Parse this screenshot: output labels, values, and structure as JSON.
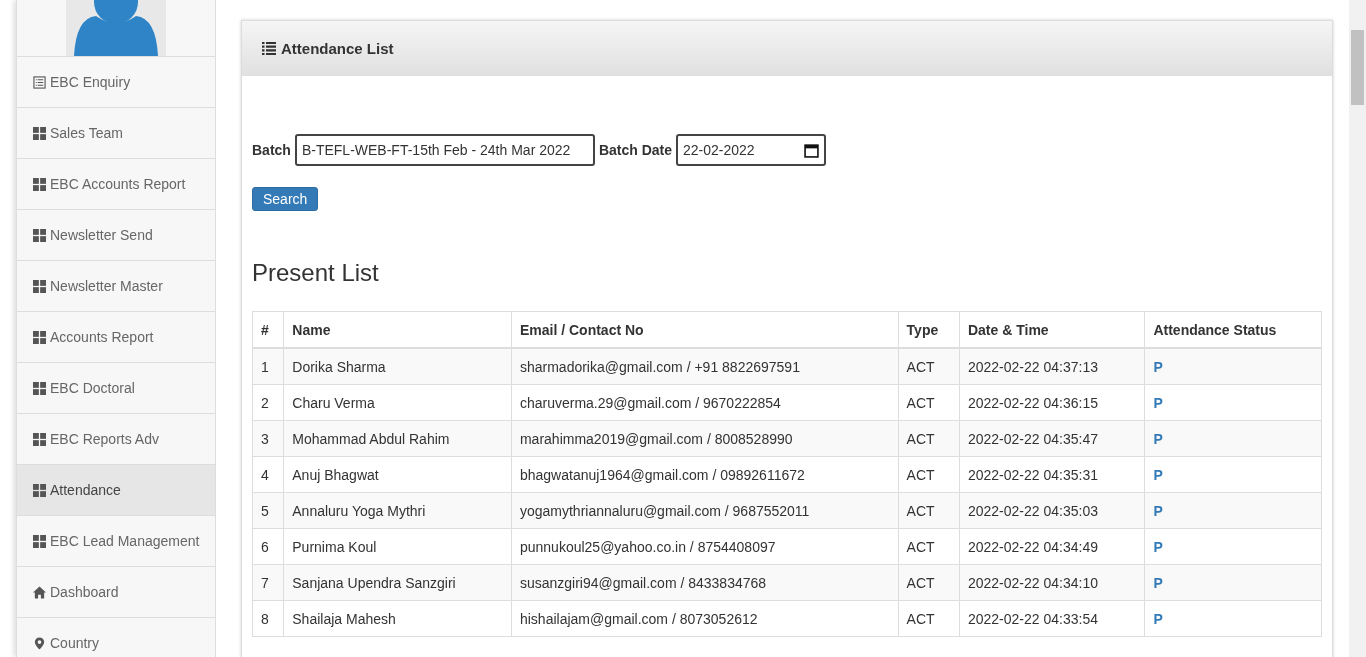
{
  "sidebar": {
    "items": [
      {
        "label": "EBC Enquiry",
        "kind": "list",
        "selected": false
      },
      {
        "label": "Sales Team",
        "kind": "grid",
        "selected": false
      },
      {
        "label": "EBC Accounts Report",
        "kind": "grid",
        "selected": false
      },
      {
        "label": "Newsletter Send",
        "kind": "grid",
        "selected": false
      },
      {
        "label": "Newsletter Master",
        "kind": "grid",
        "selected": false
      },
      {
        "label": "Accounts Report",
        "kind": "grid",
        "selected": false
      },
      {
        "label": "EBC Doctoral",
        "kind": "grid",
        "selected": false
      },
      {
        "label": "EBC Reports Adv",
        "kind": "grid",
        "selected": false
      },
      {
        "label": "Attendance",
        "kind": "grid",
        "selected": true
      },
      {
        "label": "EBC Lead Management",
        "kind": "grid",
        "selected": false
      },
      {
        "label": "Dashboard",
        "kind": "home",
        "selected": false
      },
      {
        "label": "Country",
        "kind": "pin",
        "selected": false
      }
    ]
  },
  "panel": {
    "title": "Attendance List",
    "form": {
      "batch_label": "Batch",
      "batch_value": "B-TEFL-WEB-FT-15th Feb - 24th Mar 2022",
      "date_label": "Batch Date",
      "date_value": "22-02-2022",
      "button": "Search"
    },
    "section_title": "Present List",
    "table": {
      "columns": [
        "#",
        "Name",
        "Email / Contact No",
        "Type",
        "Date & Time",
        "Attendance Status"
      ],
      "rows": [
        [
          "1",
          "Dorika Sharma",
          "sharmadorika@gmail.com / +91 8822697591",
          "ACT",
          "2022-02-22 04:37:13",
          "P"
        ],
        [
          "2",
          "Charu Verma",
          "charuverma.29@gmail.com / 9670222854",
          "ACT",
          "2022-02-22 04:36:15",
          "P"
        ],
        [
          "3",
          "Mohammad Abdul Rahim",
          "marahimma2019@gmail.com / 8008528990",
          "ACT",
          "2022-02-22 04:35:47",
          "P"
        ],
        [
          "4",
          "Anuj Bhagwat",
          "bhagwatanuj1964@gmail.com / 09892611672",
          "ACT",
          "2022-02-22 04:35:31",
          "P"
        ],
        [
          "5",
          "Annaluru Yoga Mythri",
          "yogamythriannaluru@gmail.com / 9687552011",
          "ACT",
          "2022-02-22 04:35:03",
          "P"
        ],
        [
          "6",
          "Purnima Koul",
          "punnukoul25@yahoo.co.in / 8754408097",
          "ACT",
          "2022-02-22 04:34:49",
          "P"
        ],
        [
          "7",
          "Sanjana Upendra Sanzgiri",
          "susanzgiri94@gmail.com / 8433834768",
          "ACT",
          "2022-02-22 04:34:10",
          "P"
        ],
        [
          "8",
          "Shailaja Mahesh",
          "hishailajam@gmail.com / 8073052612",
          "ACT",
          "2022-02-22 04:33:54",
          "P"
        ]
      ]
    }
  }
}
